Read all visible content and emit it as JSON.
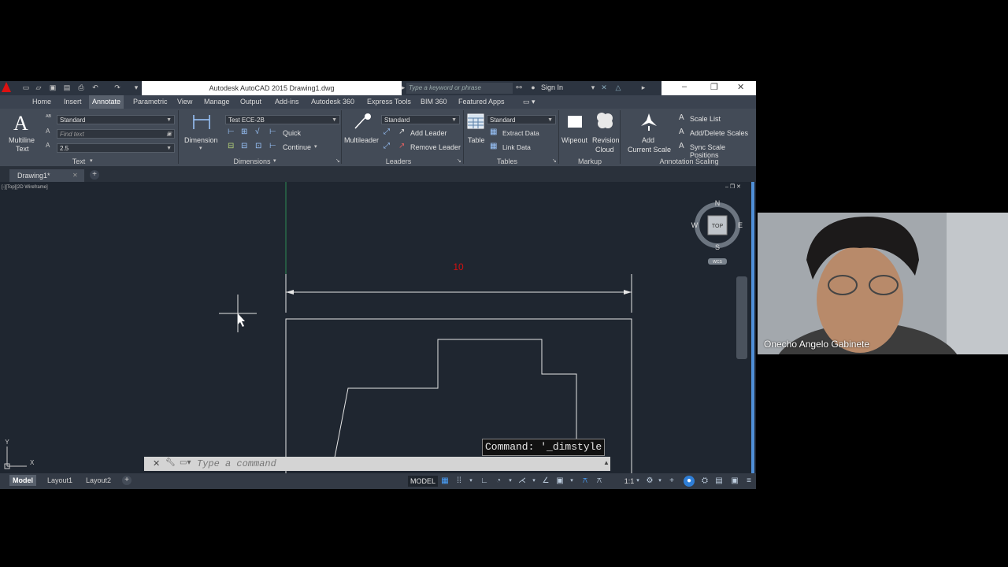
{
  "window": {
    "title": "Autodesk AutoCAD 2015    Drawing1.dwg",
    "search_placeholder": "Type a keyword or phrase",
    "sign_in": "Sign In"
  },
  "menu_tabs": [
    "Home",
    "Insert",
    "Annotate",
    "Parametric",
    "View",
    "Manage",
    "Output",
    "Add-ins",
    "Autodesk 360",
    "Express Tools",
    "BIM 360",
    "Featured Apps"
  ],
  "active_tab": "Annotate",
  "ribbon": {
    "text_panel": {
      "multiline_label": "Multiline",
      "text_label": "Text",
      "style": "Standard",
      "find_placeholder": "Find text",
      "height": "2.5",
      "title": "Text"
    },
    "dimensions_panel": {
      "dimension_label": "Dimension",
      "style": "Test ECE-2B",
      "quick": "Quick",
      "continue": "Continue",
      "title": "Dimensions"
    },
    "leaders_panel": {
      "multileader_label": "Multileader",
      "style": "Standard",
      "add_leader": "Add Leader",
      "remove_leader": "Remove Leader",
      "title": "Leaders"
    },
    "tables_panel": {
      "table_label": "Table",
      "style": "Standard",
      "extract_data": "Extract Data",
      "link_data": "Link Data",
      "title": "Tables"
    },
    "markup_panel": {
      "wipeout": "Wipeout",
      "revision": "Revision",
      "cloud": "Cloud",
      "title": "Markup"
    },
    "scaling_panel": {
      "add": "Add",
      "current_scale": "Current Scale",
      "scale_list": "Scale List",
      "add_delete_scales": "Add/Delete Scales",
      "sync_scale_positions": "Sync Scale Positions",
      "title": "Annotation Scaling"
    }
  },
  "document_tab": "Drawing1*",
  "viewport": {
    "label": "[-][Top][2D Wireframe]",
    "dimension_text": "10",
    "viewcube": {
      "n": "N",
      "s": "S",
      "e": "E",
      "w": "W",
      "top": "TOP",
      "wcs": "WCS"
    },
    "ucs_y": "Y",
    "ucs_x": "X"
  },
  "command": {
    "history": "Command: '_dimstyle",
    "placeholder": "Type a command"
  },
  "layout_tabs": [
    "Model",
    "Layout1",
    "Layout2"
  ],
  "status": {
    "model": "MODEL",
    "scale": "1:1"
  },
  "participant": {
    "name": "Onecho Angelo Gabinete"
  },
  "colors": {
    "ribbon_bg": "#434b57",
    "viewport_bg": "#1f2630",
    "dimension_text": "#d01010",
    "accent": "#2f7fd8"
  }
}
